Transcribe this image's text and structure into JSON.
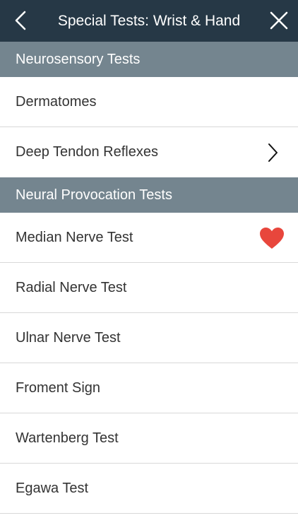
{
  "header": {
    "title": "Special Tests: Wrist & Hand",
    "back_icon": "chevron-left-icon",
    "close_icon": "close-icon"
  },
  "sections": [
    {
      "title": "Neurosensory Tests",
      "items": [
        {
          "label": "Dermatomes"
        },
        {
          "label": "Deep Tendon Reflexes",
          "accessory": "chevron-right-icon"
        }
      ]
    },
    {
      "title": "Neural Provocation Tests",
      "items": [
        {
          "label": "Median Nerve Test",
          "accessory": "heart-icon",
          "favorite": true
        },
        {
          "label": "Radial Nerve Test"
        },
        {
          "label": "Ulnar Nerve Test"
        },
        {
          "label": "Froment Sign"
        },
        {
          "label": "Wartenberg Test"
        },
        {
          "label": "Egawa Test"
        }
      ]
    }
  ],
  "colors": {
    "navbar": "#263846",
    "section_header": "#74858f",
    "favorite": "#e8463c",
    "text": "#333333",
    "divider": "#d8d8d8"
  }
}
